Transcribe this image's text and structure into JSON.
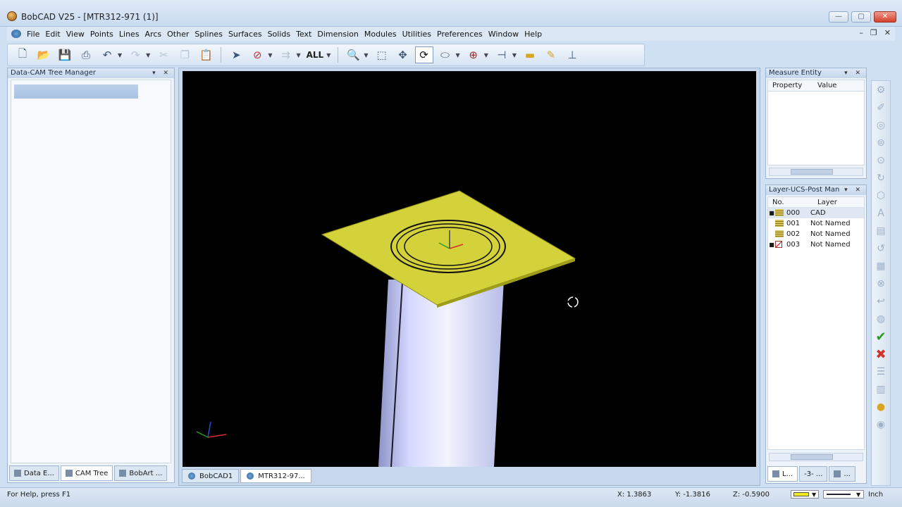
{
  "window": {
    "title": "BobCAD V25 - [MTR312-971 (1)]",
    "min_glyph": "—",
    "max_glyph": "▢",
    "close_glyph": "✕"
  },
  "menu": {
    "items": [
      "File",
      "Edit",
      "View",
      "Points",
      "Lines",
      "Arcs",
      "Other",
      "Splines",
      "Surfaces",
      "Solids",
      "Text",
      "Dimension",
      "Modules",
      "Utilities",
      "Preferences",
      "Window",
      "Help"
    ],
    "mdi_min": "–",
    "mdi_restore": "❐",
    "mdi_close": "✕"
  },
  "toolbar": {
    "all_label": "ALL",
    "icons": [
      "new-file-icon",
      "open-folder-icon",
      "save-icon",
      "print-icon",
      "undo-icon",
      "redo-icon",
      "cut-icon",
      "copy-icon",
      "paste-icon",
      "select-arrow-icon",
      "select-entity-icon",
      "select-filter-icon",
      "zoom-icon",
      "zoom-window-icon",
      "pan-icon",
      "rotate-icon",
      "view-plane-icon",
      "ucs-icon",
      "measure-icon",
      "ruler-icon",
      "highlight-icon",
      "workplane-icon"
    ]
  },
  "left_panel": {
    "title": "Data-CAM Tree Manager",
    "pins": "▾ ✕",
    "tabs": [
      "Data E...",
      "CAM Tree",
      "BobArt ..."
    ]
  },
  "viewport": {
    "background": "#000000",
    "plate_color": "#d4d23a",
    "cylinder_color": "#c8cdf5",
    "doc_tabs": [
      "BobCAD1",
      "MTR312-97..."
    ]
  },
  "measure_panel": {
    "title": "Measure Entity",
    "pins": "▾ ✕",
    "columns": [
      "Property",
      "Value"
    ]
  },
  "layer_panel": {
    "title": "Layer-UCS-Post Man",
    "pins": "▾ ✕",
    "columns": [
      "No.",
      "Layer"
    ],
    "rows": [
      {
        "bullet": "■",
        "no": "000",
        "name": "CAD"
      },
      {
        "bullet": "",
        "no": "001",
        "name": "Not Named"
      },
      {
        "bullet": "",
        "no": "002",
        "name": "Not Named"
      },
      {
        "bullet": "■",
        "no": "003",
        "name": "Not Named"
      }
    ],
    "tabs": [
      "L...",
      "-3- ...",
      "..."
    ]
  },
  "vtoolbar": {
    "icons": [
      "wizard-icon",
      "wand-icon",
      "feature-icon",
      "drill-icon",
      "pocket-icon",
      "profile-icon",
      "chamfer-icon",
      "engrave-icon",
      "face-icon",
      "thread-icon",
      "roughing-icon",
      "finishing-icon",
      "tool-icon",
      "stock-icon",
      "check-icon",
      "cancel-icon",
      "list-icon",
      "grid-icon",
      "layer-icon",
      "target-icon"
    ],
    "check_color": "#2a9a2a",
    "cancel_color": "#d0332a"
  },
  "status": {
    "help_text": "For Help, press F1",
    "x": "X: 1.3863",
    "y": "Y: -1.3816",
    "z": "Z: -0.5900",
    "units": "Inch",
    "color_swatch": "#f1ec1f"
  }
}
